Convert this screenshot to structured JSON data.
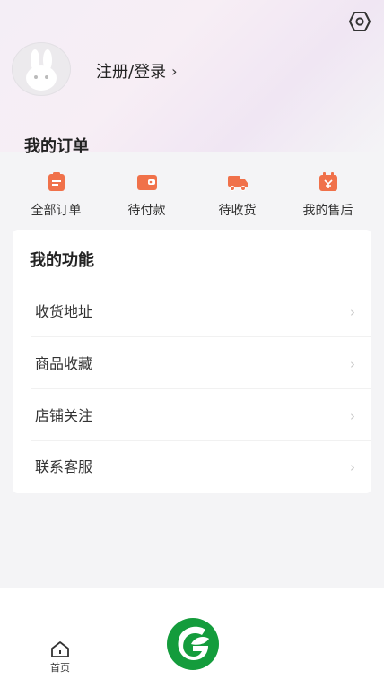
{
  "header": {
    "settings_icon": "settings-icon",
    "avatar_icon": "rabbit-avatar-icon",
    "login_label": "注册/登录",
    "login_chevron": "›"
  },
  "orders": {
    "title": "我的订单",
    "items": [
      {
        "label": "全部订单",
        "icon": "clipboard-icon"
      },
      {
        "label": "待付款",
        "icon": "wallet-icon"
      },
      {
        "label": "待收货",
        "icon": "truck-icon"
      },
      {
        "label": "我的售后",
        "icon": "after-sales-icon"
      }
    ]
  },
  "functions": {
    "title": "我的功能",
    "items": [
      {
        "label": "收货地址",
        "arrow": "›"
      },
      {
        "label": "商品收藏",
        "arrow": "›"
      },
      {
        "label": "店铺关注",
        "arrow": "›"
      },
      {
        "label": "联系客服",
        "arrow": "›"
      }
    ]
  },
  "tabbar": {
    "home_label": "首页",
    "home_icon": "home-icon",
    "logo_icon": "green-g-logo-icon"
  },
  "colors": {
    "accent_orange": "#f0714a",
    "logo_green": "#149c3c",
    "background": "#f4f4f6"
  }
}
